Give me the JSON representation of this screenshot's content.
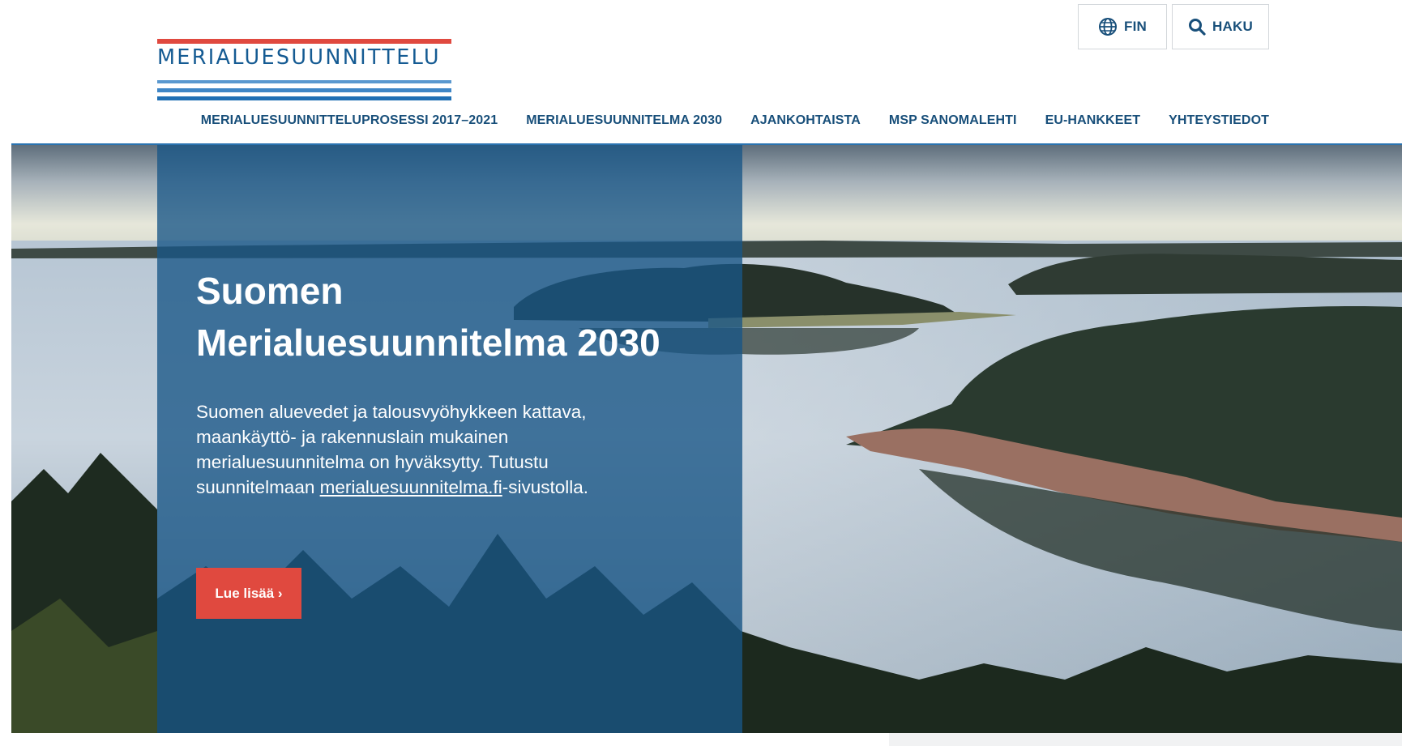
{
  "header": {
    "logo_text": "MERIALUESUUNNITTELU",
    "language_label": "FIN",
    "search_label": "HAKU"
  },
  "nav": {
    "items": [
      {
        "label": "MERIALUESUUNNITTELUPROSESSI 2017–2021"
      },
      {
        "label": "MERIALUESUUNNITELMA 2030"
      },
      {
        "label": "AJANKOHTAISTA"
      },
      {
        "label": "MSP SANOMALEHTI"
      },
      {
        "label": "EU-HANKKEET"
      },
      {
        "label": "YHTEYSTIEDOT"
      }
    ]
  },
  "hero": {
    "title_line1": "Suomen",
    "title_line2": "Merialuesuunnitelma 2030",
    "body_text": "Suomen aluevedet ja talousvyöhykkeen kattava, maankäyttö- ja rakennuslain mukainen merialuesuunnitelma on hyväksytty. Tutustu suunnitelmaan ",
    "body_link": "merialuesuunnitelma.fi",
    "body_suffix": "-sivustolla.",
    "cta_label": "Lue lisää ›"
  },
  "colors": {
    "brand_blue": "#184f7a",
    "accent_red": "#e0493f",
    "panel_blue": "#185687"
  },
  "icons": {
    "language": "globe-icon",
    "search": "search-icon"
  }
}
